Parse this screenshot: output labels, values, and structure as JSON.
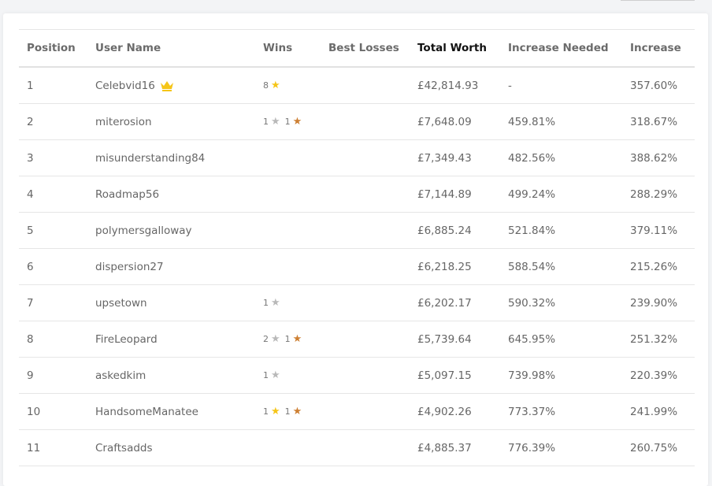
{
  "table": {
    "headers": {
      "position": "Position",
      "user": "User Name",
      "wins": "Wins",
      "losses": "Best Losses",
      "worth": "Total Worth",
      "need": "Increase Needed",
      "increase": "Increase"
    },
    "rows": [
      {
        "position": "1",
        "user": "Celebvid16",
        "crown": true,
        "wins": [
          {
            "count": "8",
            "medal": "gold"
          }
        ],
        "worth": "£42,814.93",
        "need": "-",
        "increase": "357.60%"
      },
      {
        "position": "2",
        "user": "miterosion",
        "crown": false,
        "wins": [
          {
            "count": "1",
            "medal": "silver"
          },
          {
            "count": "1",
            "medal": "bronze"
          }
        ],
        "worth": "£7,648.09",
        "need": "459.81%",
        "increase": "318.67%"
      },
      {
        "position": "3",
        "user": "misunderstanding84",
        "crown": false,
        "wins": [],
        "worth": "£7,349.43",
        "need": "482.56%",
        "increase": "388.62%"
      },
      {
        "position": "4",
        "user": "Roadmap56",
        "crown": false,
        "wins": [],
        "worth": "£7,144.89",
        "need": "499.24%",
        "increase": "288.29%"
      },
      {
        "position": "5",
        "user": "polymersgalloway",
        "crown": false,
        "wins": [],
        "worth": "£6,885.24",
        "need": "521.84%",
        "increase": "379.11%"
      },
      {
        "position": "6",
        "user": "dispersion27",
        "crown": false,
        "wins": [],
        "worth": "£6,218.25",
        "need": "588.54%",
        "increase": "215.26%"
      },
      {
        "position": "7",
        "user": "upsetown",
        "crown": false,
        "wins": [
          {
            "count": "1",
            "medal": "silver"
          }
        ],
        "worth": "£6,202.17",
        "need": "590.32%",
        "increase": "239.90%"
      },
      {
        "position": "8",
        "user": "FireLeopard",
        "crown": false,
        "wins": [
          {
            "count": "2",
            "medal": "silver"
          },
          {
            "count": "1",
            "medal": "bronze"
          }
        ],
        "worth": "£5,739.64",
        "need": "645.95%",
        "increase": "251.32%"
      },
      {
        "position": "9",
        "user": "askedkim",
        "crown": false,
        "wins": [
          {
            "count": "1",
            "medal": "silver"
          }
        ],
        "worth": "£5,097.15",
        "need": "739.98%",
        "increase": "220.39%"
      },
      {
        "position": "10",
        "user": "HandsomeManatee",
        "crown": false,
        "wins": [
          {
            "count": "1",
            "medal": "gold"
          },
          {
            "count": "1",
            "medal": "bronze"
          }
        ],
        "worth": "£4,902.26",
        "need": "773.37%",
        "increase": "241.99%"
      },
      {
        "position": "11",
        "user": "Craftsadds",
        "crown": false,
        "wins": [],
        "worth": "£4,885.37",
        "need": "776.39%",
        "increase": "260.75%"
      }
    ]
  },
  "colors": {
    "gold": "#f5c518",
    "silver": "#b9b9b9",
    "bronze": "#cd7f32",
    "crown": "#f5c518"
  },
  "icons": {
    "medal": "star-icon",
    "leader": "crown-icon"
  }
}
